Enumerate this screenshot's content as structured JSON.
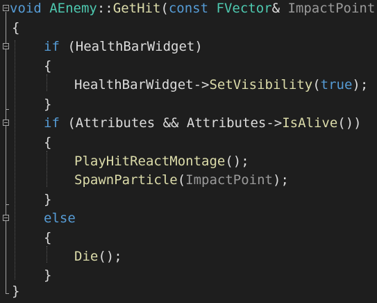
{
  "code": {
    "line1": {
      "kw_void": "void",
      "type_class": "AEnemy",
      "scope_op": "::",
      "func_name": "GetHit",
      "open_paren": "(",
      "kw_const": "const",
      "type_param": "FVector",
      "ref": "&",
      "param_name": "ImpactPoint",
      "close_paren": ")"
    },
    "line2": {
      "brace": "{"
    },
    "line3": {
      "kw_if": "if",
      "rest": "(HealthBarWidget)"
    },
    "line4": {
      "brace": "{"
    },
    "line5": {
      "obj": "HealthBarWidget",
      "arrow": "->",
      "call": "SetVisibility",
      "open": "(",
      "kw_true": "true",
      "close": ");"
    },
    "line6": {
      "brace": "}"
    },
    "line7": {
      "kw_if": "if",
      "cond_start": "(Attributes && Attributes->",
      "call": "IsAlive",
      "cond_end": "())"
    },
    "line8": {
      "brace": "{"
    },
    "line9": {
      "call": "PlayHitReactMontage",
      "rest": "();"
    },
    "line10": {
      "call": "SpawnParticle",
      "open": "(",
      "arg": "ImpactPoint",
      "close": ");"
    },
    "line11": {
      "brace": "}"
    },
    "line12": {
      "kw_else": "else"
    },
    "line13": {
      "brace": "{"
    },
    "line14": {
      "call": "Die",
      "rest": "();"
    },
    "line15": {
      "brace": "}"
    },
    "line16": {
      "brace": "}"
    }
  },
  "colors": {
    "background": "#1e1e1e",
    "keyword": "#569cd6",
    "type": "#4ec9b0",
    "function": "#dcdcaa",
    "parameter": "#9a9a9a",
    "text": "#dcdcdc"
  }
}
